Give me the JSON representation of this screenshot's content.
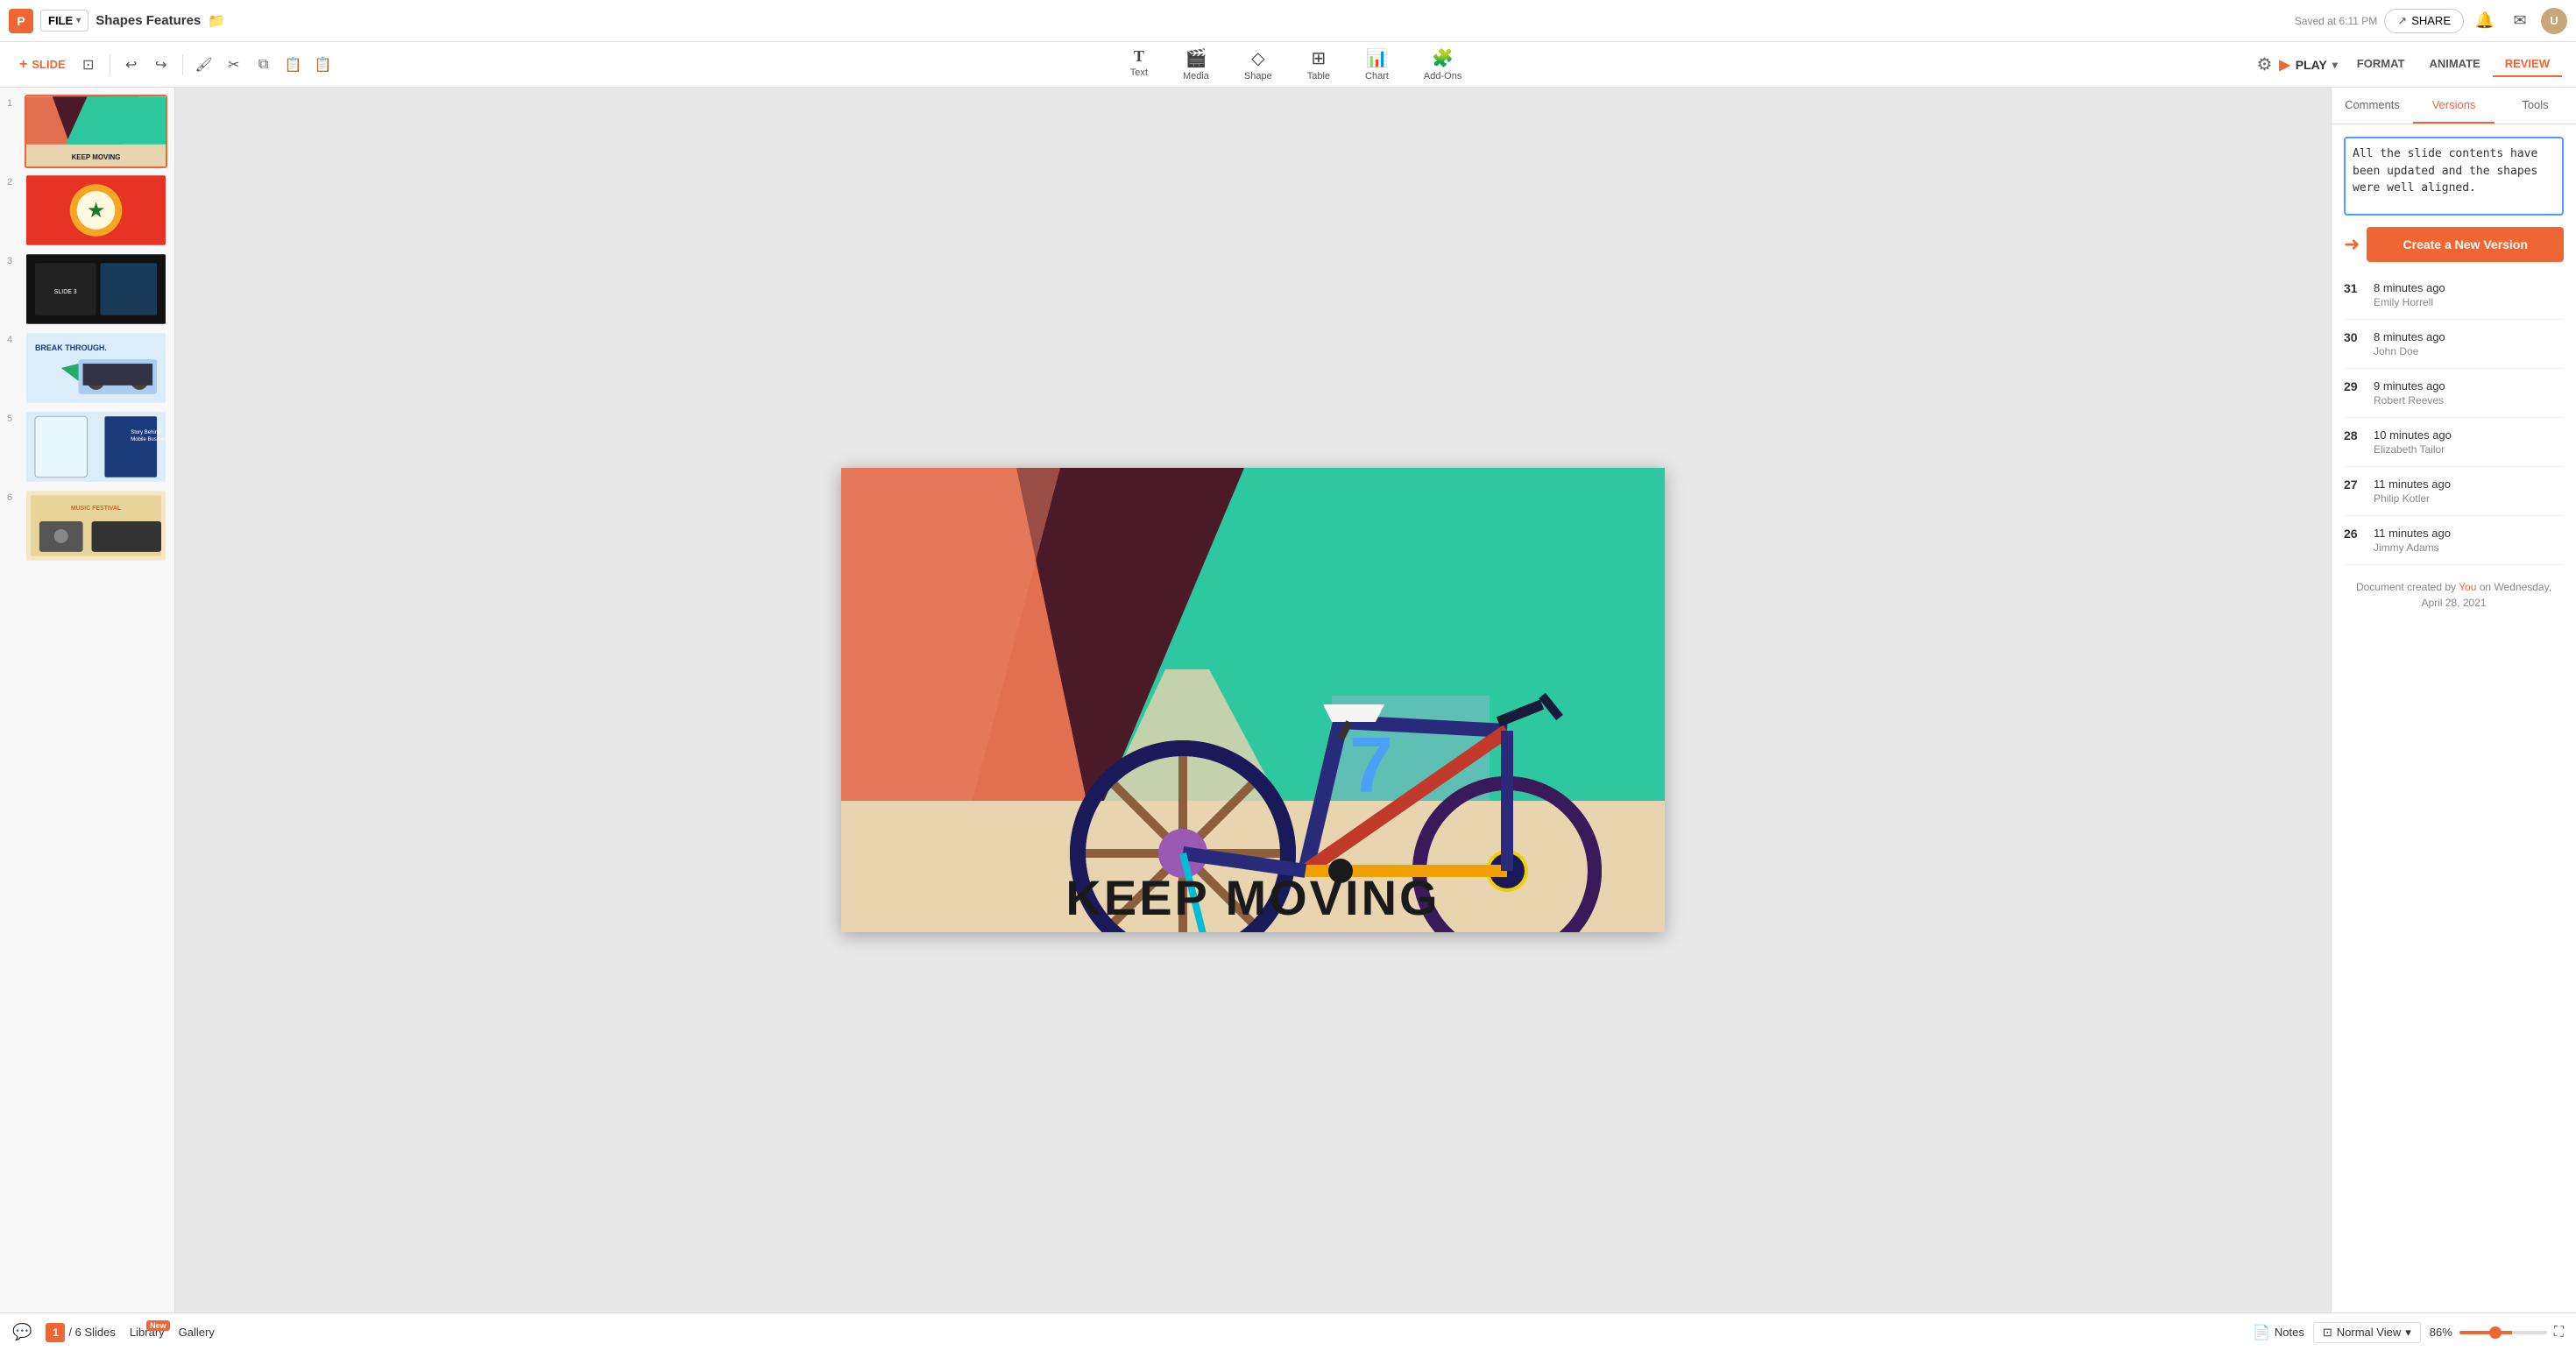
{
  "app": {
    "logo": "P",
    "file_label": "FILE",
    "doc_title": "Shapes Features",
    "saved_text": "Saved at 6:11 PM",
    "share_label": "SHARE"
  },
  "toolbar": {
    "slide_label": "SLIDE",
    "tools": [
      {
        "id": "text",
        "label": "Text",
        "icon": "T"
      },
      {
        "id": "media",
        "label": "Media",
        "icon": "🎬"
      },
      {
        "id": "shape",
        "label": "Shape",
        "icon": "⬟"
      },
      {
        "id": "table",
        "label": "Table",
        "icon": "⊞"
      },
      {
        "id": "chart",
        "label": "Chart",
        "icon": "📊"
      },
      {
        "id": "addons",
        "label": "Add-Ons",
        "icon": "🧩"
      }
    ],
    "play_label": "PLAY",
    "format_label": "FORMAT",
    "animate_label": "ANIMATE",
    "review_label": "REVIEW"
  },
  "slides": [
    {
      "num": 1,
      "active": true
    },
    {
      "num": 2,
      "active": false
    },
    {
      "num": 3,
      "active": false
    },
    {
      "num": 4,
      "active": false
    },
    {
      "num": 5,
      "active": false
    },
    {
      "num": 6,
      "active": false
    }
  ],
  "main_slide": {
    "title": "KEEP MOVING"
  },
  "right_panel": {
    "tabs": [
      "Comments",
      "Versions",
      "Tools"
    ],
    "active_tab": "Versions",
    "textarea_content": "All the slide contents have been updated and the shapes were well aligned.",
    "create_btn_label": "Create a New Version",
    "versions": [
      {
        "num": 31,
        "time": "8 minutes ago",
        "author": "Emily Horrell"
      },
      {
        "num": 30,
        "time": "8 minutes ago",
        "author": "John Doe"
      },
      {
        "num": 29,
        "time": "9 minutes ago",
        "author": "Robert Reeves"
      },
      {
        "num": 28,
        "time": "10 minutes ago",
        "author": "Elizabeth Tailor"
      },
      {
        "num": 27,
        "time": "11 minutes ago",
        "author": "Philip Kotler"
      },
      {
        "num": 26,
        "time": "11 minutes ago",
        "author": "Jimmy Adams"
      }
    ],
    "created_by_label": "Document created by",
    "created_by_you": "You",
    "created_by_date": "on Wednesday, April 28, 2021"
  },
  "bottom_bar": {
    "slide_current": "1",
    "slide_total": "/ 6 Slides",
    "notes_label": "Notes",
    "view_mode": "Normal View",
    "zoom_percent": "86%",
    "library_label": "Library",
    "library_badge": "New",
    "gallery_label": "Gallery"
  }
}
